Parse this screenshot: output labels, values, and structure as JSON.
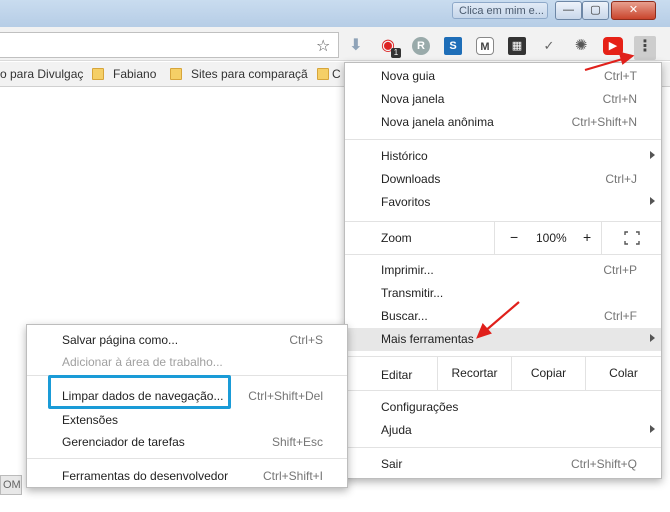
{
  "window": {
    "title": "Clica em mim e...",
    "minimize": "—",
    "maximize": "▢",
    "close": "✕"
  },
  "toolbar": {
    "menu_icon": "⋮",
    "badge": "1",
    "extensions": [
      "download-icon",
      "opera-icon",
      "r-icon",
      "s-icon",
      "m-icon",
      "film-icon",
      "check-icon",
      "swirl-icon",
      "youtube-icon"
    ]
  },
  "bookmarks": [
    {
      "label": "o para Divulgaç"
    },
    {
      "label": "Fabiano"
    },
    {
      "label": "Sites para comparaçã"
    },
    {
      "label": "C"
    }
  ],
  "menu": {
    "new_tab": {
      "label": "Nova guia",
      "shortcut": "Ctrl+T"
    },
    "new_window": {
      "label": "Nova janela",
      "shortcut": "Ctrl+N"
    },
    "incognito": {
      "label": "Nova janela anônima",
      "shortcut": "Ctrl+Shift+N"
    },
    "history": {
      "label": "Histórico"
    },
    "downloads": {
      "label": "Downloads",
      "shortcut": "Ctrl+J"
    },
    "bookmarks": {
      "label": "Favoritos"
    },
    "zoom": {
      "label": "Zoom",
      "minus": "−",
      "value": "100%",
      "plus": "+"
    },
    "print": {
      "label": "Imprimir...",
      "shortcut": "Ctrl+P"
    },
    "cast": {
      "label": "Transmitir..."
    },
    "find": {
      "label": "Buscar...",
      "shortcut": "Ctrl+F"
    },
    "more_tools": {
      "label": "Mais ferramentas"
    },
    "edit": {
      "label": "Editar",
      "cut": "Recortar",
      "copy": "Copiar",
      "paste": "Colar"
    },
    "settings": {
      "label": "Configurações"
    },
    "help": {
      "label": "Ajuda"
    },
    "exit": {
      "label": "Sair",
      "shortcut": "Ctrl+Shift+Q"
    }
  },
  "submenu": {
    "save_page": {
      "label": "Salvar página como...",
      "shortcut": "Ctrl+S"
    },
    "add_desktop": {
      "label": "Adicionar à área de trabalho..."
    },
    "clear_data": {
      "label": "Limpar dados de navegação...",
      "shortcut": "Ctrl+Shift+Del"
    },
    "extensions": {
      "label": "Extensões"
    },
    "task_manager": {
      "label": "Gerenciador de tarefas",
      "shortcut": "Shift+Esc"
    },
    "dev_tools": {
      "label": "Ferramentas do desenvolvedor",
      "shortcut": "Ctrl+Shift+I"
    }
  },
  "page": {
    "fragment": "OM"
  },
  "colors": {
    "highlight_box": "#1a9bd7",
    "arrow": "#e0201b",
    "hover": "#e7e7e7"
  }
}
